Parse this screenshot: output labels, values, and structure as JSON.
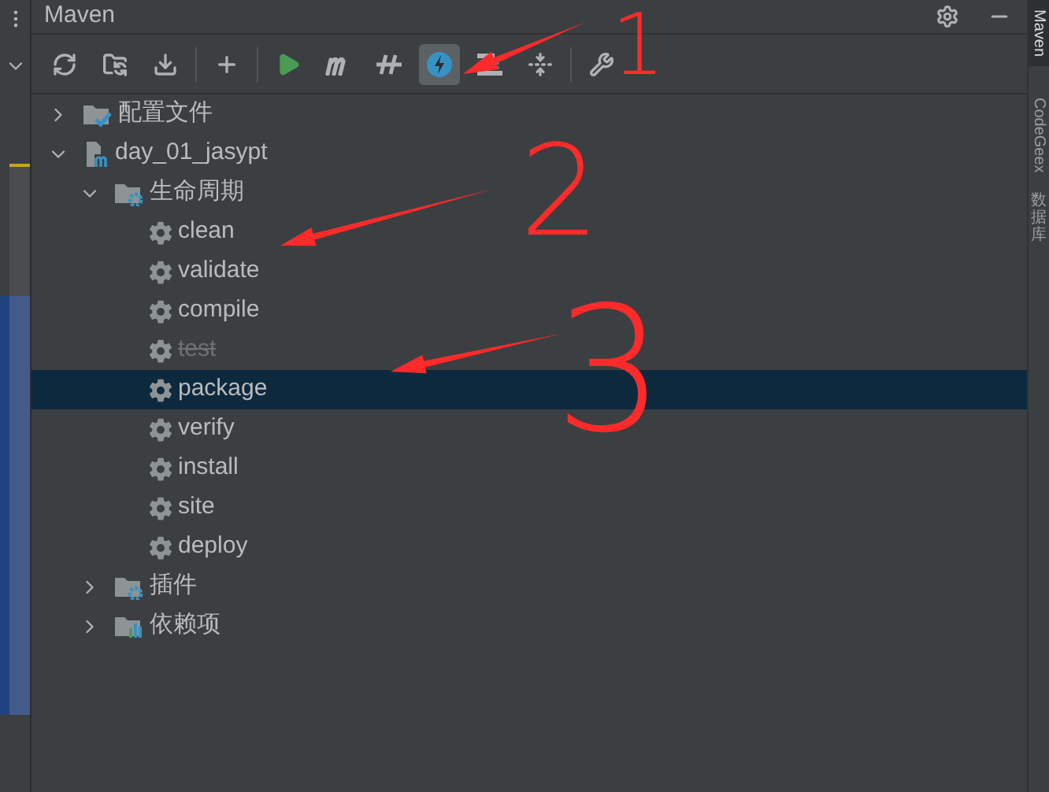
{
  "panel": {
    "title": "Maven"
  },
  "toolbar": [
    {
      "kind": "reload",
      "selected": false
    },
    {
      "kind": "folder-sync",
      "selected": false
    },
    {
      "kind": "download",
      "selected": false
    },
    {
      "kind": "separator"
    },
    {
      "kind": "add",
      "selected": false
    },
    {
      "kind": "separator"
    },
    {
      "kind": "run",
      "selected": false
    },
    {
      "kind": "maven-goal",
      "selected": false
    },
    {
      "kind": "skip-tests",
      "selected": false
    },
    {
      "kind": "offline",
      "selected": true
    },
    {
      "kind": "show-deps",
      "selected": false
    },
    {
      "kind": "collapse",
      "selected": false
    },
    {
      "kind": "separator"
    },
    {
      "kind": "settings",
      "selected": false
    }
  ],
  "tree": [
    {
      "label": "配置文件",
      "kind": "profiles",
      "expanded": false,
      "selected": false
    },
    {
      "label": "day_01_jasypt",
      "kind": "project",
      "expanded": true,
      "selected": false,
      "children": [
        {
          "label": "生命周期",
          "kind": "lifecycle",
          "expanded": true,
          "selected": false,
          "children": [
            {
              "label": "clean",
              "kind": "goal",
              "skipped": false,
              "selected": false
            },
            {
              "label": "validate",
              "kind": "goal",
              "skipped": false,
              "selected": false
            },
            {
              "label": "compile",
              "kind": "goal",
              "skipped": false,
              "selected": false
            },
            {
              "label": "test",
              "kind": "goal",
              "skipped": true,
              "selected": false
            },
            {
              "label": "package",
              "kind": "goal",
              "skipped": false,
              "selected": true
            },
            {
              "label": "verify",
              "kind": "goal",
              "skipped": false,
              "selected": false
            },
            {
              "label": "install",
              "kind": "goal",
              "skipped": false,
              "selected": false
            },
            {
              "label": "site",
              "kind": "goal",
              "skipped": false,
              "selected": false
            },
            {
              "label": "deploy",
              "kind": "goal",
              "skipped": false,
              "selected": false
            }
          ]
        },
        {
          "label": "插件",
          "kind": "plugins",
          "expanded": false,
          "selected": false
        },
        {
          "label": "依赖项",
          "kind": "dependencies",
          "expanded": false,
          "selected": false
        }
      ]
    }
  ],
  "side_tabs": [
    {
      "label": "Maven",
      "kind": "latin",
      "selected": true
    },
    {
      "label": "CodeGeex",
      "kind": "latin",
      "selected": false
    },
    {
      "label": "数据库",
      "kind": "cjk",
      "selected": false
    }
  ],
  "annotations": [
    "1",
    "2",
    "3"
  ]
}
